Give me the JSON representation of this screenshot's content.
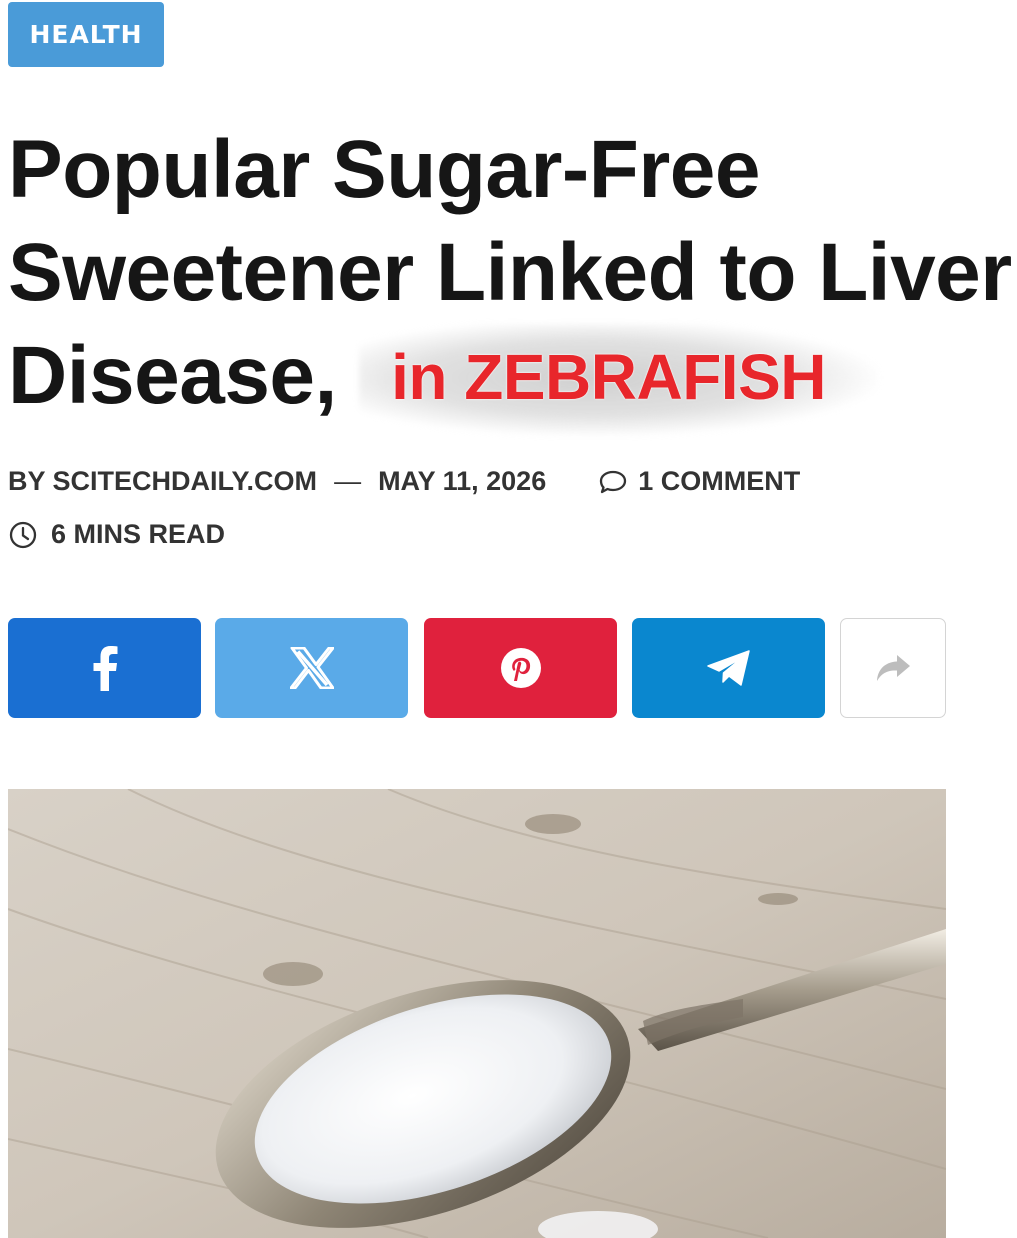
{
  "category": {
    "label": "HEALTH"
  },
  "headline": {
    "line1": "Popular Sugar-Free",
    "line2": "Sweetener Linked to Liver",
    "line3": "Disease,",
    "overlay_annotation": "in ZEBRAFISH"
  },
  "meta": {
    "byline": "BY SCITECHDAILY.COM",
    "separator": "—",
    "date": "MAY 11, 2026",
    "comments": "1 COMMENT",
    "read_time": "6 MINS READ"
  },
  "share": {
    "buttons": [
      {
        "network": "facebook",
        "icon": "facebook-icon",
        "color": "#1a6fd2"
      },
      {
        "network": "x",
        "icon": "x-icon",
        "color": "#5aaae8"
      },
      {
        "network": "pinterest",
        "icon": "pinterest-icon",
        "color": "#e0213d"
      },
      {
        "network": "telegram",
        "icon": "telegram-icon",
        "color": "#0a87cf"
      },
      {
        "network": "more",
        "icon": "share-arrow-icon",
        "color": "#ffffff"
      }
    ]
  },
  "hero": {
    "subject": "spoon-of-sweetener-photo"
  },
  "colors": {
    "badge": "#4a9bd8",
    "headline": "#161616",
    "overlay_red": "#e8262b",
    "meta_text": "#333333"
  }
}
